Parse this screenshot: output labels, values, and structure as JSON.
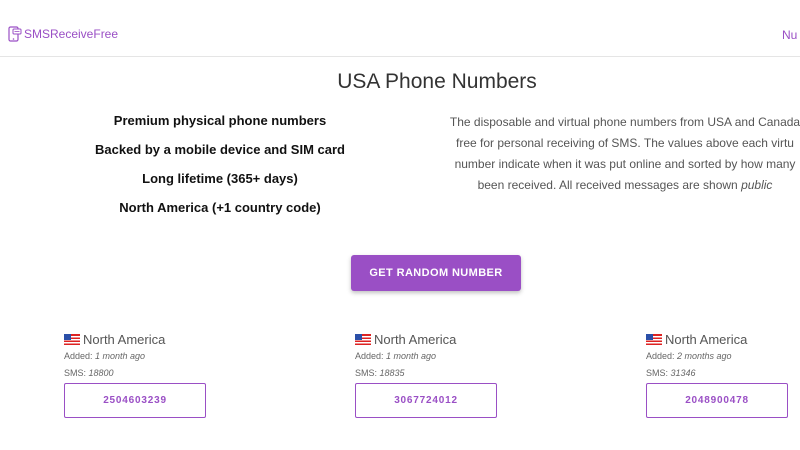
{
  "header": {
    "logo_text": "SMSReceiveFree",
    "nav_partial": "Nu"
  },
  "title": "USA Phone Numbers",
  "features": [
    "Premium physical phone numbers",
    "Backed by a mobile device and SIM card",
    "Long lifetime (365+ days)",
    "North America (+1 country code)"
  ],
  "description": {
    "line1": "The disposable and virtual phone numbers from USA and Canada",
    "line2": "free for personal receiving of SMS. The values above each virtu",
    "line3": "number indicate when it was put online and sorted by how many",
    "line4_main": "been received. All received messages are shown ",
    "line4_em": "public"
  },
  "button": {
    "label": "GET RANDOM NUMBER"
  },
  "labels": {
    "added": "Added: ",
    "sms": "SMS: "
  },
  "cards": [
    {
      "region": "North America",
      "added": "1 month ago",
      "sms": "18800",
      "number": "2504603239"
    },
    {
      "region": "North America",
      "added": "1 month ago",
      "sms": "18835",
      "number": "3067724012"
    },
    {
      "region": "North America",
      "added": "2 months ago",
      "sms": "31346",
      "number": "2048900478"
    }
  ],
  "colors": {
    "accent": "#9a4fc5",
    "text_dark": "#111111",
    "text_muted": "#555555"
  },
  "icons": {
    "logo": "phone-sms-icon",
    "flag": "flag-icon"
  }
}
